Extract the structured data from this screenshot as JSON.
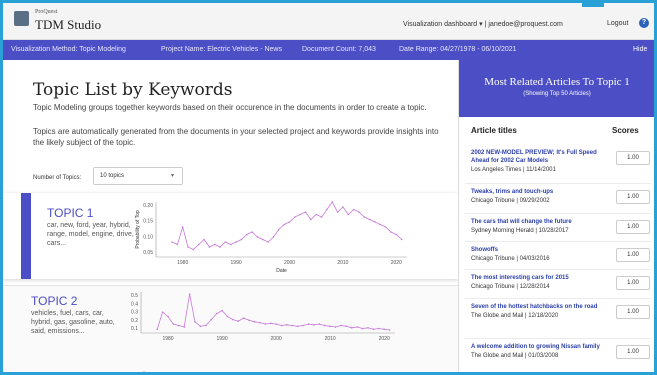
{
  "header": {
    "brand_small": "ProQuest",
    "brand": "TDM Studio",
    "dashboard": "Visualization dashboard ▾ | janedoe@proquest.com",
    "logout": "Logout",
    "help": "?"
  },
  "infobar": {
    "method": "Visualization Method: Topic Modeling",
    "project": "Project Name: Electric Vehicles - News",
    "count": "Document Count: 7,043",
    "range": "Date Range: 04/27/1978 - 06/10/2021",
    "hide": "Hide"
  },
  "main": {
    "title": "Topic List by Keywords",
    "desc1": "Topic Modeling groups together keywords based on their occurence in the documents in order to create a topic.",
    "desc2": "Topics are automatically generated from the documents in your selected project and keywords provide insights into the likely subject of the topic.",
    "num_topics_label": "Number of Topics:",
    "num_topics_value": "10 topics"
  },
  "topics": [
    {
      "title": "TOPIC 1",
      "keywords": "car, new, ford, year, hybrid, range, model, engine, drive, cars...",
      "chart_ylabel": "Probability of Top",
      "chart_xlabel": "Date",
      "yticks": [
        "0.20",
        "0.15",
        "0.10",
        "0.05"
      ],
      "xticks": [
        "1980",
        "1990",
        "2000",
        "2010",
        "2020"
      ]
    },
    {
      "title": "TOPIC 2",
      "keywords": "vehicles, fuel, cars, car, hybrid, gas, gasoline, auto, said, emissions...",
      "yticks": [
        "0.5",
        "0.4",
        "0.3",
        "0.2",
        "0.1"
      ],
      "xticks": [
        "1980",
        "1990",
        "2000",
        "2010",
        "2020"
      ]
    }
  ],
  "chart_data": [
    {
      "type": "line",
      "ylabel": "Probability of Top",
      "xlabel": "Date",
      "x": [
        1978,
        1979,
        1980,
        1981,
        1982,
        1983,
        1984,
        1985,
        1986,
        1987,
        1988,
        1989,
        1990,
        1991,
        1992,
        1993,
        1994,
        1995,
        1996,
        1997,
        1998,
        1999,
        2000,
        2001,
        2002,
        2003,
        2004,
        2005,
        2006,
        2007,
        2008,
        2009,
        2010,
        2011,
        2012,
        2013,
        2014,
        2015,
        2016,
        2017,
        2018,
        2019,
        2020,
        2021
      ],
      "values": [
        0.06,
        0.05,
        0.12,
        0.04,
        0.03,
        0.05,
        0.07,
        0.04,
        0.05,
        0.04,
        0.06,
        0.05,
        0.06,
        0.07,
        0.09,
        0.1,
        0.08,
        0.07,
        0.06,
        0.08,
        0.11,
        0.13,
        0.14,
        0.16,
        0.17,
        0.18,
        0.15,
        0.17,
        0.16,
        0.19,
        0.22,
        0.18,
        0.2,
        0.17,
        0.19,
        0.18,
        0.16,
        0.15,
        0.14,
        0.13,
        0.12,
        0.1,
        0.09,
        0.07
      ],
      "ylim": [
        0.0,
        0.22
      ],
      "xlim": [
        1975,
        2022
      ]
    },
    {
      "type": "line",
      "x": [
        1978,
        1979,
        1980,
        1981,
        1982,
        1983,
        1984,
        1985,
        1986,
        1987,
        1988,
        1989,
        1990,
        1991,
        1992,
        1993,
        1994,
        1995,
        1996,
        1997,
        1998,
        1999,
        2000,
        2001,
        2002,
        2003,
        2004,
        2005,
        2006,
        2007,
        2008,
        2009,
        2010,
        2011,
        2012,
        2013,
        2014,
        2015,
        2016,
        2017,
        2018,
        2019,
        2020,
        2021
      ],
      "values": [
        0.05,
        0.28,
        0.22,
        0.12,
        0.1,
        0.08,
        0.52,
        0.15,
        0.09,
        0.1,
        0.18,
        0.26,
        0.3,
        0.22,
        0.18,
        0.16,
        0.2,
        0.17,
        0.15,
        0.14,
        0.12,
        0.13,
        0.12,
        0.1,
        0.11,
        0.1,
        0.09,
        0.1,
        0.12,
        0.11,
        0.12,
        0.1,
        0.09,
        0.08,
        0.1,
        0.09,
        0.07,
        0.08,
        0.06,
        0.07,
        0.05,
        0.06,
        0.05,
        0.04
      ],
      "ylim": [
        0.0,
        0.55
      ],
      "xlim": [
        1975,
        2022
      ]
    }
  ],
  "right": {
    "title": "Most Related Articles To Topic 1",
    "subtitle": "(Showing Top 50 Articles)",
    "col_titles": "Article titles",
    "col_scores": "Scores",
    "articles": [
      {
        "title": "2002 NEW-MODEL PREVIEW; It's Full Speed Ahead for 2002 Car Models",
        "source": "Los Angeles Times | 11/14/2001",
        "score": "1.00"
      },
      {
        "title": "Tweaks, trims and touch-ups",
        "source": "Chicago Tribune | 09/29/2002",
        "score": "1.00"
      },
      {
        "title": "The cars that will change the future",
        "source": "Sydney Morning Herald | 10/28/2017",
        "score": "1.00"
      },
      {
        "title": "Showoffs",
        "source": "Chicago Tribune | 04/03/2016",
        "score": "1.00"
      },
      {
        "title": "The most interesting cars for 2015",
        "source": "Chicago Tribune | 12/28/2014",
        "score": "1.00"
      },
      {
        "title": "Seven of the hottest hatchbacks on the road",
        "source": "The Globe and Mail | 12/18/2020",
        "score": "1.00"
      },
      {
        "title": "A welcome addition to growing Nissan family",
        "source": "The Globe and Mail | 01/03/2008",
        "score": "1.00"
      }
    ]
  },
  "colors": {
    "accent": "#4b4ec4",
    "line": "#c77ad8",
    "frame": "#2aa1d6"
  }
}
